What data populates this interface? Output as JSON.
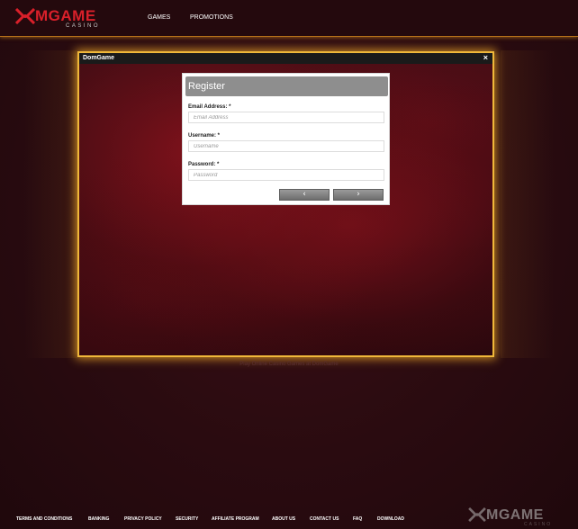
{
  "brand": {
    "wordmark": "MGAME",
    "tagline": "CASINO",
    "logo_icon": "x-mark-icon",
    "accent_color": "#d9202a",
    "glow_color": "#f0b83a"
  },
  "nav": {
    "items": [
      {
        "label": "GAMES"
      },
      {
        "label": "PROMOTIONS"
      }
    ]
  },
  "modal": {
    "title": "DomGame",
    "close_label": "×"
  },
  "register": {
    "title": "Register",
    "fields": [
      {
        "label": "Email Address: *",
        "placeholder": "Email Address",
        "value": ""
      },
      {
        "label": "Username: *",
        "placeholder": "Username",
        "value": ""
      },
      {
        "label": "Password: *",
        "placeholder": "Password",
        "value": ""
      }
    ],
    "prev_label": "‹",
    "next_label": "›"
  },
  "seo_text": "Play Online Casino Games at DomGame",
  "footer": {
    "links": [
      {
        "label": "TERMS AND CONDITIONS"
      },
      {
        "label": "BANKING"
      },
      {
        "label": "PRIVACY POLICY"
      },
      {
        "label": "SECURITY"
      },
      {
        "label": "AFFILIATE PROGRAM"
      },
      {
        "label": "ABOUT US"
      },
      {
        "label": "CONTACT US"
      },
      {
        "label": "FAQ"
      },
      {
        "label": "DOWNLOAD"
      }
    ],
    "logo_wordmark": "MGAME",
    "logo_tagline": "CASINO"
  }
}
